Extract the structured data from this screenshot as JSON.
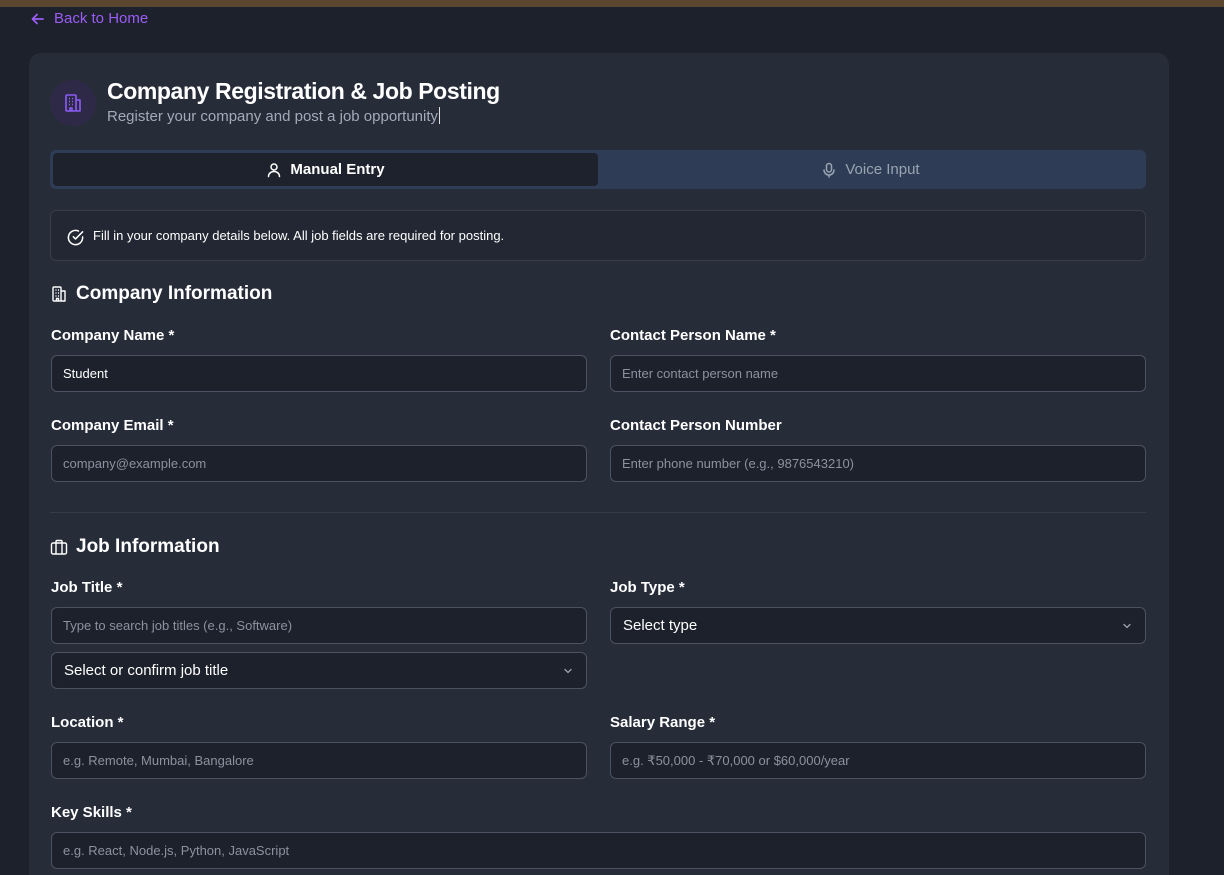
{
  "nav": {
    "back_label": "Back to Home"
  },
  "header": {
    "title": "Company Registration & Job Posting",
    "subtitle": "Register your company and post a job opportunity"
  },
  "tabs": [
    {
      "label": "Manual Entry",
      "icon": "user-icon",
      "active": true
    },
    {
      "label": "Voice Input",
      "icon": "microphone-icon",
      "active": false
    }
  ],
  "notice": {
    "text": "Fill in your company details below. All job fields are required for posting.",
    "icon": "check-circle-icon"
  },
  "company_section": {
    "title": "Company Information",
    "icon": "building-icon",
    "company_name": {
      "label": "Company Name *",
      "value": "Student",
      "placeholder": ""
    },
    "contact_person_name": {
      "label": "Contact Person Name *",
      "value": "",
      "placeholder": "Enter contact person name"
    },
    "company_email": {
      "label": "Company Email *",
      "value": "",
      "placeholder": "company@example.com"
    },
    "contact_person_number": {
      "label": "Contact Person Number",
      "value": "",
      "placeholder": "Enter phone number (e.g., 9876543210)"
    }
  },
  "job_section": {
    "title": "Job Information",
    "icon": "briefcase-icon",
    "job_title": {
      "label": "Job Title *",
      "placeholder": "Type to search job titles (e.g., Software)",
      "select_value": "Select or confirm job title"
    },
    "job_type": {
      "label": "Job Type *",
      "select_value": "Select type"
    },
    "location": {
      "label": "Location *",
      "placeholder": "e.g. Remote, Mumbai, Bangalore"
    },
    "salary_range": {
      "label": "Salary Range *",
      "placeholder": "e.g. ₹50,000 - ₹70,000 or $60,000/year"
    },
    "key_skills": {
      "label": "Key Skills *",
      "placeholder": "e.g. React, Node.js, Python, JavaScript"
    }
  },
  "colors": {
    "accent": "#9b5cf6",
    "background": "#1d212b",
    "card": "#272c39",
    "tab_bar": "#2e3d55"
  }
}
